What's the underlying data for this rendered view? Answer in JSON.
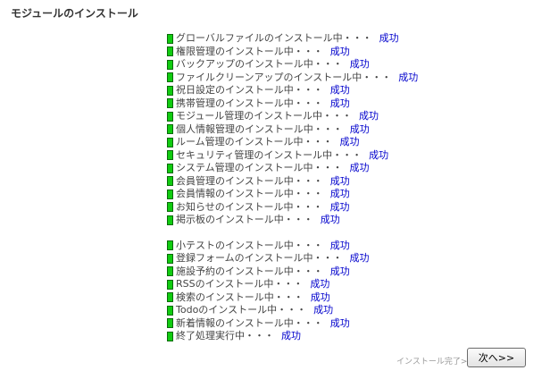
{
  "page": {
    "title": "モジュールのインストール"
  },
  "install_groups": [
    {
      "items": [
        {
          "text": "グローバルファイルのインストール中・・・",
          "result": "成功"
        },
        {
          "text": "権限管理のインストール中・・・",
          "result": "成功"
        },
        {
          "text": "バックアップのインストール中・・・",
          "result": "成功"
        },
        {
          "text": "ファイルクリーンアップのインストール中・・・",
          "result": "成功"
        },
        {
          "text": "祝日設定のインストール中・・・",
          "result": "成功"
        },
        {
          "text": "携帯管理のインストール中・・・",
          "result": "成功"
        },
        {
          "text": "モジュール管理のインストール中・・・",
          "result": "成功"
        },
        {
          "text": "個人情報管理のインストール中・・・",
          "result": "成功"
        },
        {
          "text": "ルーム管理のインストール中・・・",
          "result": "成功"
        },
        {
          "text": "セキュリティ管理のインストール中・・・",
          "result": "成功"
        },
        {
          "text": "システム管理のインストール中・・・",
          "result": "成功"
        },
        {
          "text": "会員管理のインストール中・・・",
          "result": "成功"
        },
        {
          "text": "会員情報のインストール中・・・",
          "result": "成功"
        },
        {
          "text": "お知らせのインストール中・・・",
          "result": "成功"
        },
        {
          "text": "掲示板のインストール中・・・",
          "result": "成功"
        }
      ]
    },
    {
      "items": [
        {
          "text": "小テストのインストール中・・・",
          "result": "成功"
        },
        {
          "text": "登録フォームのインストール中・・・",
          "result": "成功"
        },
        {
          "text": "施設予約のインストール中・・・",
          "result": "成功"
        },
        {
          "text": "RSSのインストール中・・・",
          "result": "成功"
        },
        {
          "text": "検索のインストール中・・・",
          "result": "成功"
        },
        {
          "text": "Todoのインストール中・・・",
          "result": "成功"
        },
        {
          "text": "新着情報のインストール中・・・",
          "result": "成功"
        },
        {
          "text": "終了処理実行中・・・",
          "result": "成功"
        }
      ]
    }
  ],
  "footer": {
    "status_text": "インストール完了>>",
    "next_button_label": "次へ>>"
  },
  "colors": {
    "marker": "#11cc11",
    "result_link": "#0000cc",
    "muted_text": "#999999"
  },
  "icons": {
    "step_marker": "success-marker-icon"
  }
}
